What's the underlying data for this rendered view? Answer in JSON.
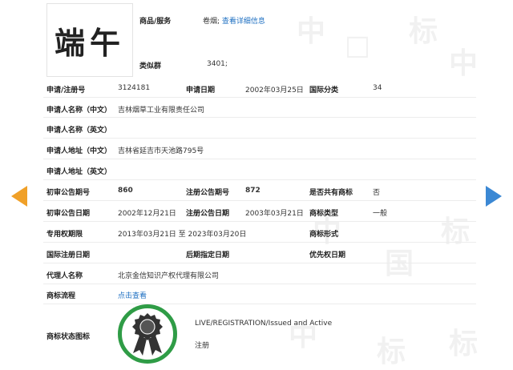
{
  "trademark": {
    "image_text": "端午"
  },
  "goods_label": "商品/服务",
  "goods_note_prefix": "卷烟;",
  "goods_link": "查看详细信息",
  "similar_label": "类似群",
  "similar_value": "3401;",
  "fields": {
    "reg_no_label": "申请/注册号",
    "reg_no": "3124181",
    "app_date_label": "申请日期",
    "app_date": "2002年03月25日",
    "intl_class_label": "国际分类",
    "intl_class": "34",
    "applicant_cn_label": "申请人名称（中文）",
    "applicant_cn": "吉林烟草工业有限责任公司",
    "applicant_en_label": "申请人名称（英文）",
    "address_cn_label": "申请人地址（中文）",
    "address_cn": "吉林省延吉市天池路795号",
    "address_en_label": "申请人地址（英文）",
    "prelim_no_label": "初审公告期号",
    "prelim_no": "860",
    "reg_pub_no_label": "注册公告期号",
    "reg_pub_no": "872",
    "shared_label": "是否共有商标",
    "shared": "否",
    "prelim_date_label": "初审公告日期",
    "prelim_date": "2002年12月21日",
    "reg_pub_date_label": "注册公告日期",
    "reg_pub_date": "2003年03月21日",
    "tm_type_label": "商标类型",
    "tm_type": "一般",
    "exclusive_label": "专用权期限",
    "exclusive": "2013年03月21日 至 2023年03月20日",
    "tm_form_label": "商标形式",
    "intl_reg_date_label": "国际注册日期",
    "later_date_label": "后期指定日期",
    "priority_date_label": "优先权日期",
    "agent_label": "代理人名称",
    "agent": "北京金信知识产权代理有限公司",
    "process_label": "商标流程",
    "process_link": "点击查看",
    "status_icon_label": "商标状态图标",
    "status_en": "LIVE/REGISTRATION/Issued and Active",
    "status_cn": "注册"
  },
  "colors": {
    "link": "#1d6fc2",
    "arrow_left": "#f0a028",
    "arrow_right": "#3b88d4",
    "status_ring": "#2f9c46"
  },
  "icons": {
    "prev": "arrow-left-icon",
    "next": "arrow-right-icon",
    "status": "award-ribbon-icon"
  }
}
